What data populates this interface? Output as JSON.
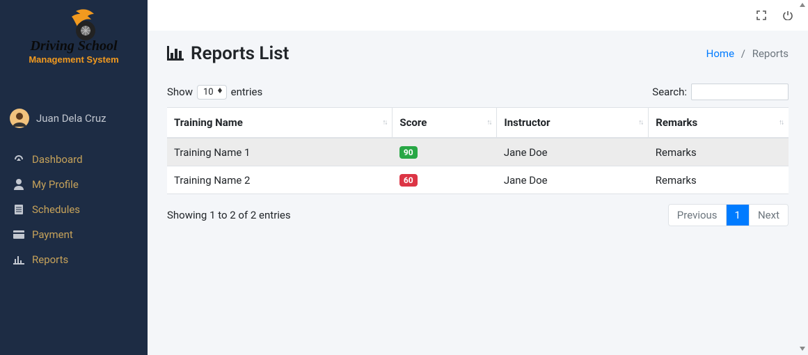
{
  "brand": {
    "line1": "Driving School",
    "line2": "Management System"
  },
  "user": {
    "name": "Juan Dela Cruz"
  },
  "nav": {
    "items": [
      {
        "label": "Dashboard"
      },
      {
        "label": "My Profile"
      },
      {
        "label": "Schedules"
      },
      {
        "label": "Payment"
      },
      {
        "label": "Reports"
      }
    ]
  },
  "page": {
    "title": "Reports List"
  },
  "breadcrumb": {
    "home": "Home",
    "sep": "/",
    "current": "Reports"
  },
  "dt": {
    "show": "Show",
    "entries": "entries",
    "length": "10",
    "searchLabel": "Search:",
    "searchValue": "",
    "info": "Showing 1 to 2 of 2 entries",
    "prev": "Previous",
    "next": "Next",
    "page1": "1"
  },
  "table": {
    "headers": [
      {
        "label": "Training Name"
      },
      {
        "label": "Score"
      },
      {
        "label": "Instructor"
      },
      {
        "label": "Remarks"
      }
    ],
    "rows": [
      {
        "name": "Training Name 1",
        "score": "90",
        "scoreClass": "green",
        "instructor": "Jane Doe",
        "remarks": "Remarks"
      },
      {
        "name": "Training Name 2",
        "score": "60",
        "scoreClass": "red",
        "instructor": "Jane Doe",
        "remarks": "Remarks"
      }
    ]
  }
}
